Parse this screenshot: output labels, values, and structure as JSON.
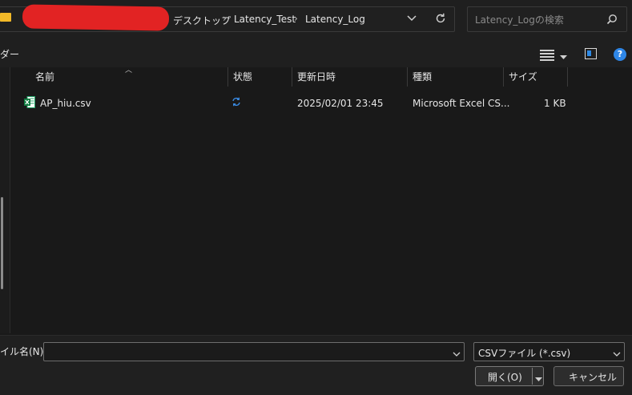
{
  "address_bar": {
    "breadcrumbs": [
      "デスクトップ",
      "Latency_Test",
      "Latency_Log"
    ],
    "separator": "›",
    "dropdown_icon": "chevron-down-icon",
    "refresh_icon": "refresh-icon"
  },
  "search": {
    "placeholder": "Latency_Logの検索",
    "icon": "search-icon"
  },
  "toolbar": {
    "partial_label": "ダー",
    "help_label": "?"
  },
  "columns": [
    {
      "key": "name",
      "label": "名前"
    },
    {
      "key": "status",
      "label": "状態"
    },
    {
      "key": "modified",
      "label": "更新日時"
    },
    {
      "key": "type",
      "label": "種類"
    },
    {
      "key": "size",
      "label": "サイズ"
    }
  ],
  "files": [
    {
      "name": "AP_hiu.csv",
      "status_icon": "sync-icon",
      "modified": "2025/02/01 23:45",
      "type": "Microsoft Excel CS...",
      "size": "1 KB"
    }
  ],
  "footer": {
    "filename_label": "イル名(N):",
    "filename_value": "",
    "filetype_selected": "CSVファイル (*.csv)",
    "open_label": "開く(O)",
    "cancel_label": "キャンセル"
  },
  "colors": {
    "background": "#191919",
    "accent": "#2e86e6",
    "redaction": "#e22323"
  }
}
